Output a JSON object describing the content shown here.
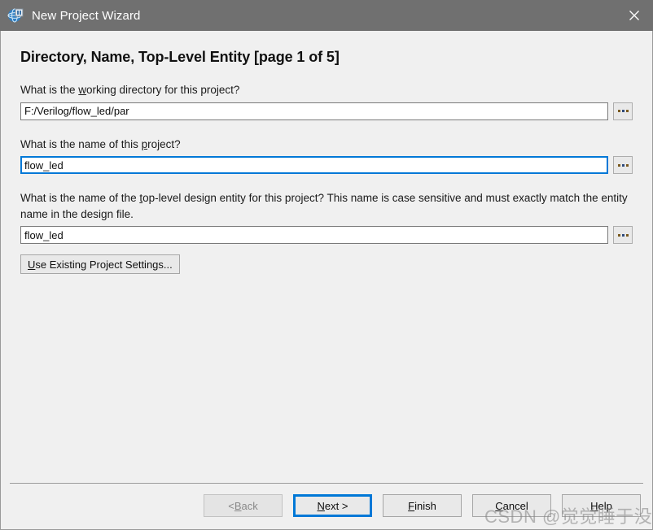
{
  "window": {
    "title": "New Project Wizard",
    "icon": "quartus-globe-icon",
    "close_label": "×",
    "titlebar_color": "#707070",
    "body_color": "#f0f0f0"
  },
  "page": {
    "heading": "Directory, Name, Top-Level Entity [page 1 of 5]"
  },
  "fields": [
    {
      "label_before": "What is the ",
      "label_accel": "w",
      "label_after": "orking directory for this project?",
      "value": "F:/Verilog/flow_led/par",
      "focused": false,
      "browse": "..."
    },
    {
      "label_before": "What is the name of this ",
      "label_accel": "p",
      "label_after": "roject?",
      "value": "flow_led",
      "focused": true,
      "browse": "..."
    },
    {
      "label_before": "What is the name of the ",
      "label_accel": "t",
      "label_after": "op-level design entity for this project? This name is case sensitive and must exactly match the entity name in the design file.",
      "value": "flow_led",
      "focused": false,
      "browse": "..."
    }
  ],
  "existing_settings_button": {
    "accel": "U",
    "rest": "se Existing Project Settings..."
  },
  "footer_buttons": [
    {
      "name": "back",
      "before": "< ",
      "accel": "B",
      "after": "ack",
      "disabled": true,
      "default": false
    },
    {
      "name": "next",
      "before": "",
      "accel": "N",
      "after": "ext >",
      "disabled": false,
      "default": true
    },
    {
      "name": "finish",
      "before": "",
      "accel": "F",
      "after": "inish",
      "disabled": false,
      "default": false
    },
    {
      "name": "cancel",
      "before": "",
      "accel": "C",
      "after": "ancel",
      "disabled": false,
      "default": false
    },
    {
      "name": "help",
      "before": "",
      "accel": "H",
      "after": "elp",
      "disabled": false,
      "default": false
    }
  ],
  "watermark": {
    "text": "CSDN @觉觉睡于没醒"
  },
  "accent": "#0078d7"
}
